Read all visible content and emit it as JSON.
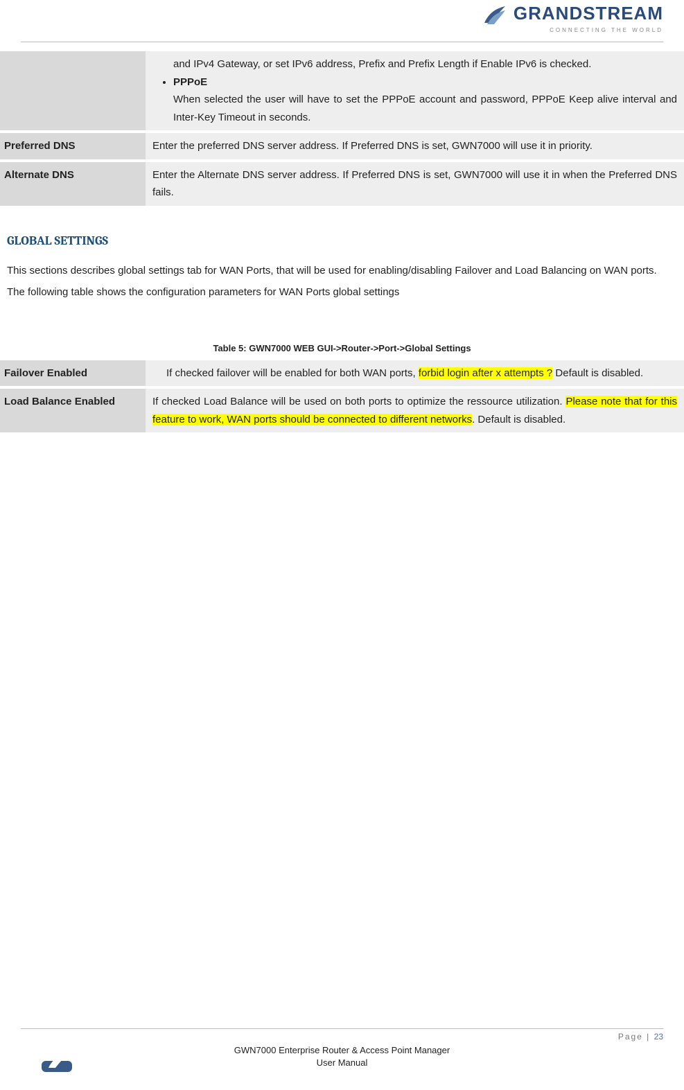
{
  "brand": {
    "name": "GRANDSTREAM",
    "tagline": "CONNECTING THE WORLD"
  },
  "table1": {
    "rows": [
      {
        "label": "",
        "desc_pre": "and IPv4 Gateway, or set IPv6 address, Prefix and Prefix Length if Enable IPv6 is checked.",
        "bullet_title": "PPPoE",
        "bullet_desc": "When selected the user will have to set the PPPoE account and password, PPPoE Keep alive interval and Inter-Key Timeout in seconds."
      },
      {
        "label": "Preferred DNS",
        "desc": "Enter the preferred DNS server address. If Preferred DNS is set, GWN7000 will use it in priority."
      },
      {
        "label": "Alternate DNS",
        "desc": "Enter the Alternate DNS server address. If Preferred DNS is set, GWN7000 will use it in when the Preferred DNS fails."
      }
    ]
  },
  "section_heading": "GLOBAL SETTINGS",
  "para1": "This sections describes global settings tab for WAN Ports, that will be used for enabling/disabling Failover and Load Balancing on WAN ports.",
  "para2": "The following table shows the configuration parameters for WAN Ports global settings",
  "table2_caption": "Table 5: GWN7000 WEB GUI->Router->Port->Global Settings",
  "table2": {
    "rows": [
      {
        "label": "Failover Enabled",
        "pre": "If checked failover will be enabled for both WAN ports, ",
        "hl": "forbid login after x attempts ?",
        "post": "   Default is disabled."
      },
      {
        "label": "Load Balance Enabled",
        "pre": "If checked Load Balance will be used on both ports to optimize the ressource utilization. ",
        "hl": "Please note that for this feature to work, WAN ports should be connected to different networks",
        "post": ". Default is disabled."
      }
    ]
  },
  "footer": {
    "page_label": "Page |",
    "page_num": "23",
    "title_line1": "GWN7000 Enterprise Router & Access Point Manager",
    "title_line2": "User Manual"
  }
}
